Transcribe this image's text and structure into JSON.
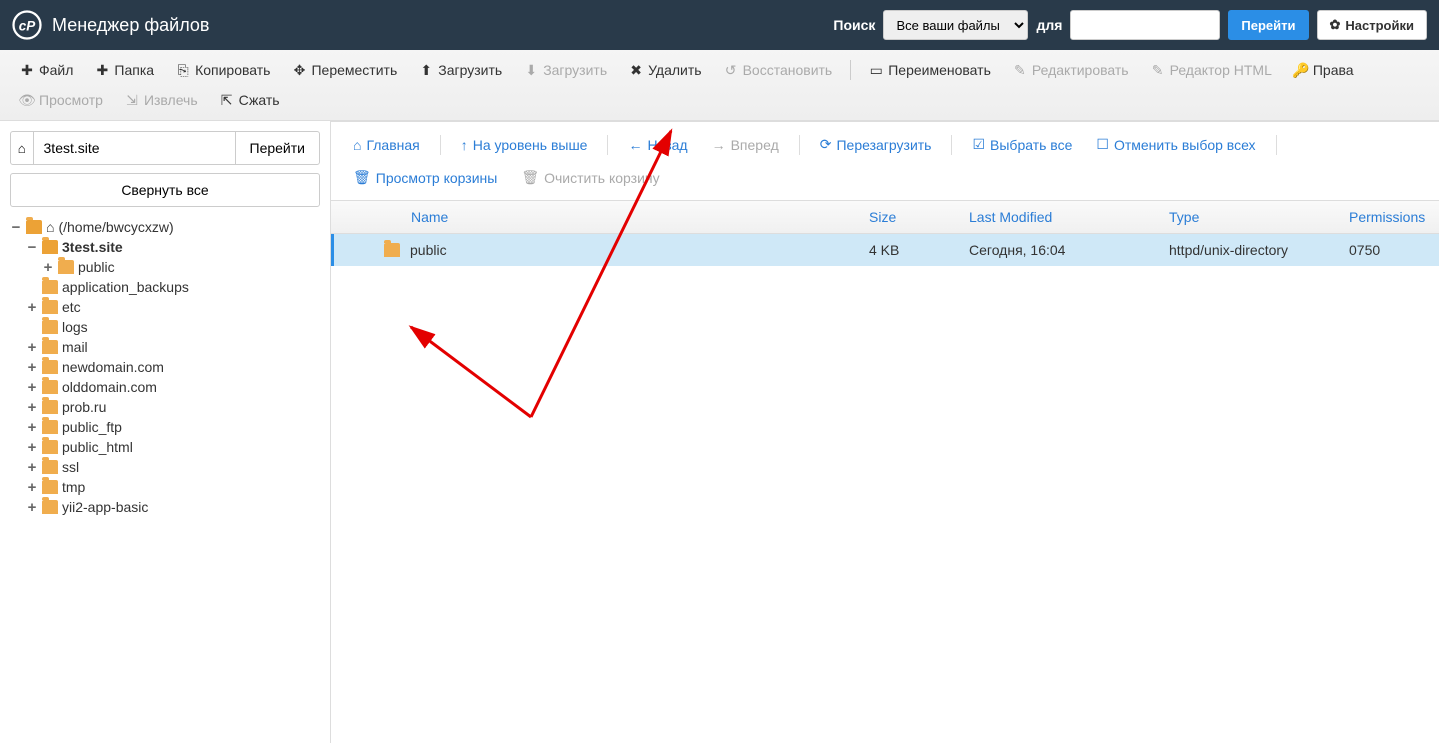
{
  "header": {
    "title": "Менеджер файлов",
    "search_label": "Поиск",
    "search_select": "Все ваши файлы",
    "for_label": "для",
    "go_btn": "Перейти",
    "settings_btn": "Настройки"
  },
  "toolbar": {
    "file": "Файл",
    "folder": "Папка",
    "copy": "Копировать",
    "move": "Переместить",
    "upload": "Загрузить",
    "download": "Загрузить",
    "delete": "Удалить",
    "restore": "Восстановить",
    "rename": "Переименовать",
    "edit": "Редактировать",
    "html_editor": "Редактор HTML",
    "rights": "Права",
    "view": "Просмотр",
    "extract": "Извлечь",
    "compress": "Сжать"
  },
  "sidebar": {
    "path_value": "3test.site",
    "go_btn": "Перейти",
    "collapse_all": "Свернуть все",
    "root_label": "(/home/bwcycxzw)",
    "tree": [
      {
        "label": "3test.site",
        "bold": true,
        "exp": "−",
        "indent": 1,
        "open": true,
        "children": [
          {
            "label": "public",
            "exp": "+",
            "indent": 2
          }
        ]
      },
      {
        "label": "application_backups",
        "exp": "",
        "indent": 1
      },
      {
        "label": "etc",
        "exp": "+",
        "indent": 1
      },
      {
        "label": "logs",
        "exp": "",
        "indent": 1
      },
      {
        "label": "mail",
        "exp": "+",
        "indent": 1
      },
      {
        "label": "newdomain.com",
        "exp": "+",
        "indent": 1
      },
      {
        "label": "olddomain.com",
        "exp": "+",
        "indent": 1
      },
      {
        "label": "prob.ru",
        "exp": "+",
        "indent": 1
      },
      {
        "label": "public_ftp",
        "exp": "+",
        "indent": 1
      },
      {
        "label": "public_html",
        "exp": "+",
        "indent": 1
      },
      {
        "label": "ssl",
        "exp": "+",
        "indent": 1
      },
      {
        "label": "tmp",
        "exp": "+",
        "indent": 1
      },
      {
        "label": "yii2-app-basic",
        "exp": "+",
        "indent": 1
      }
    ]
  },
  "content_toolbar": {
    "home": "Главная",
    "up": "На уровень выше",
    "back": "Назад",
    "forward": "Вперед",
    "reload": "Перезагрузить",
    "select_all": "Выбрать все",
    "deselect_all": "Отменить выбор всех",
    "view_trash": "Просмотр корзины",
    "empty_trash": "Очистить корзину"
  },
  "table": {
    "headers": {
      "name": "Name",
      "size": "Size",
      "modified": "Last Modified",
      "type": "Type",
      "perm": "Permissions"
    },
    "rows": [
      {
        "name": "public",
        "size": "4 KB",
        "modified": "Сегодня, 16:04",
        "type": "httpd/unix-directory",
        "perm": "0750"
      }
    ]
  }
}
